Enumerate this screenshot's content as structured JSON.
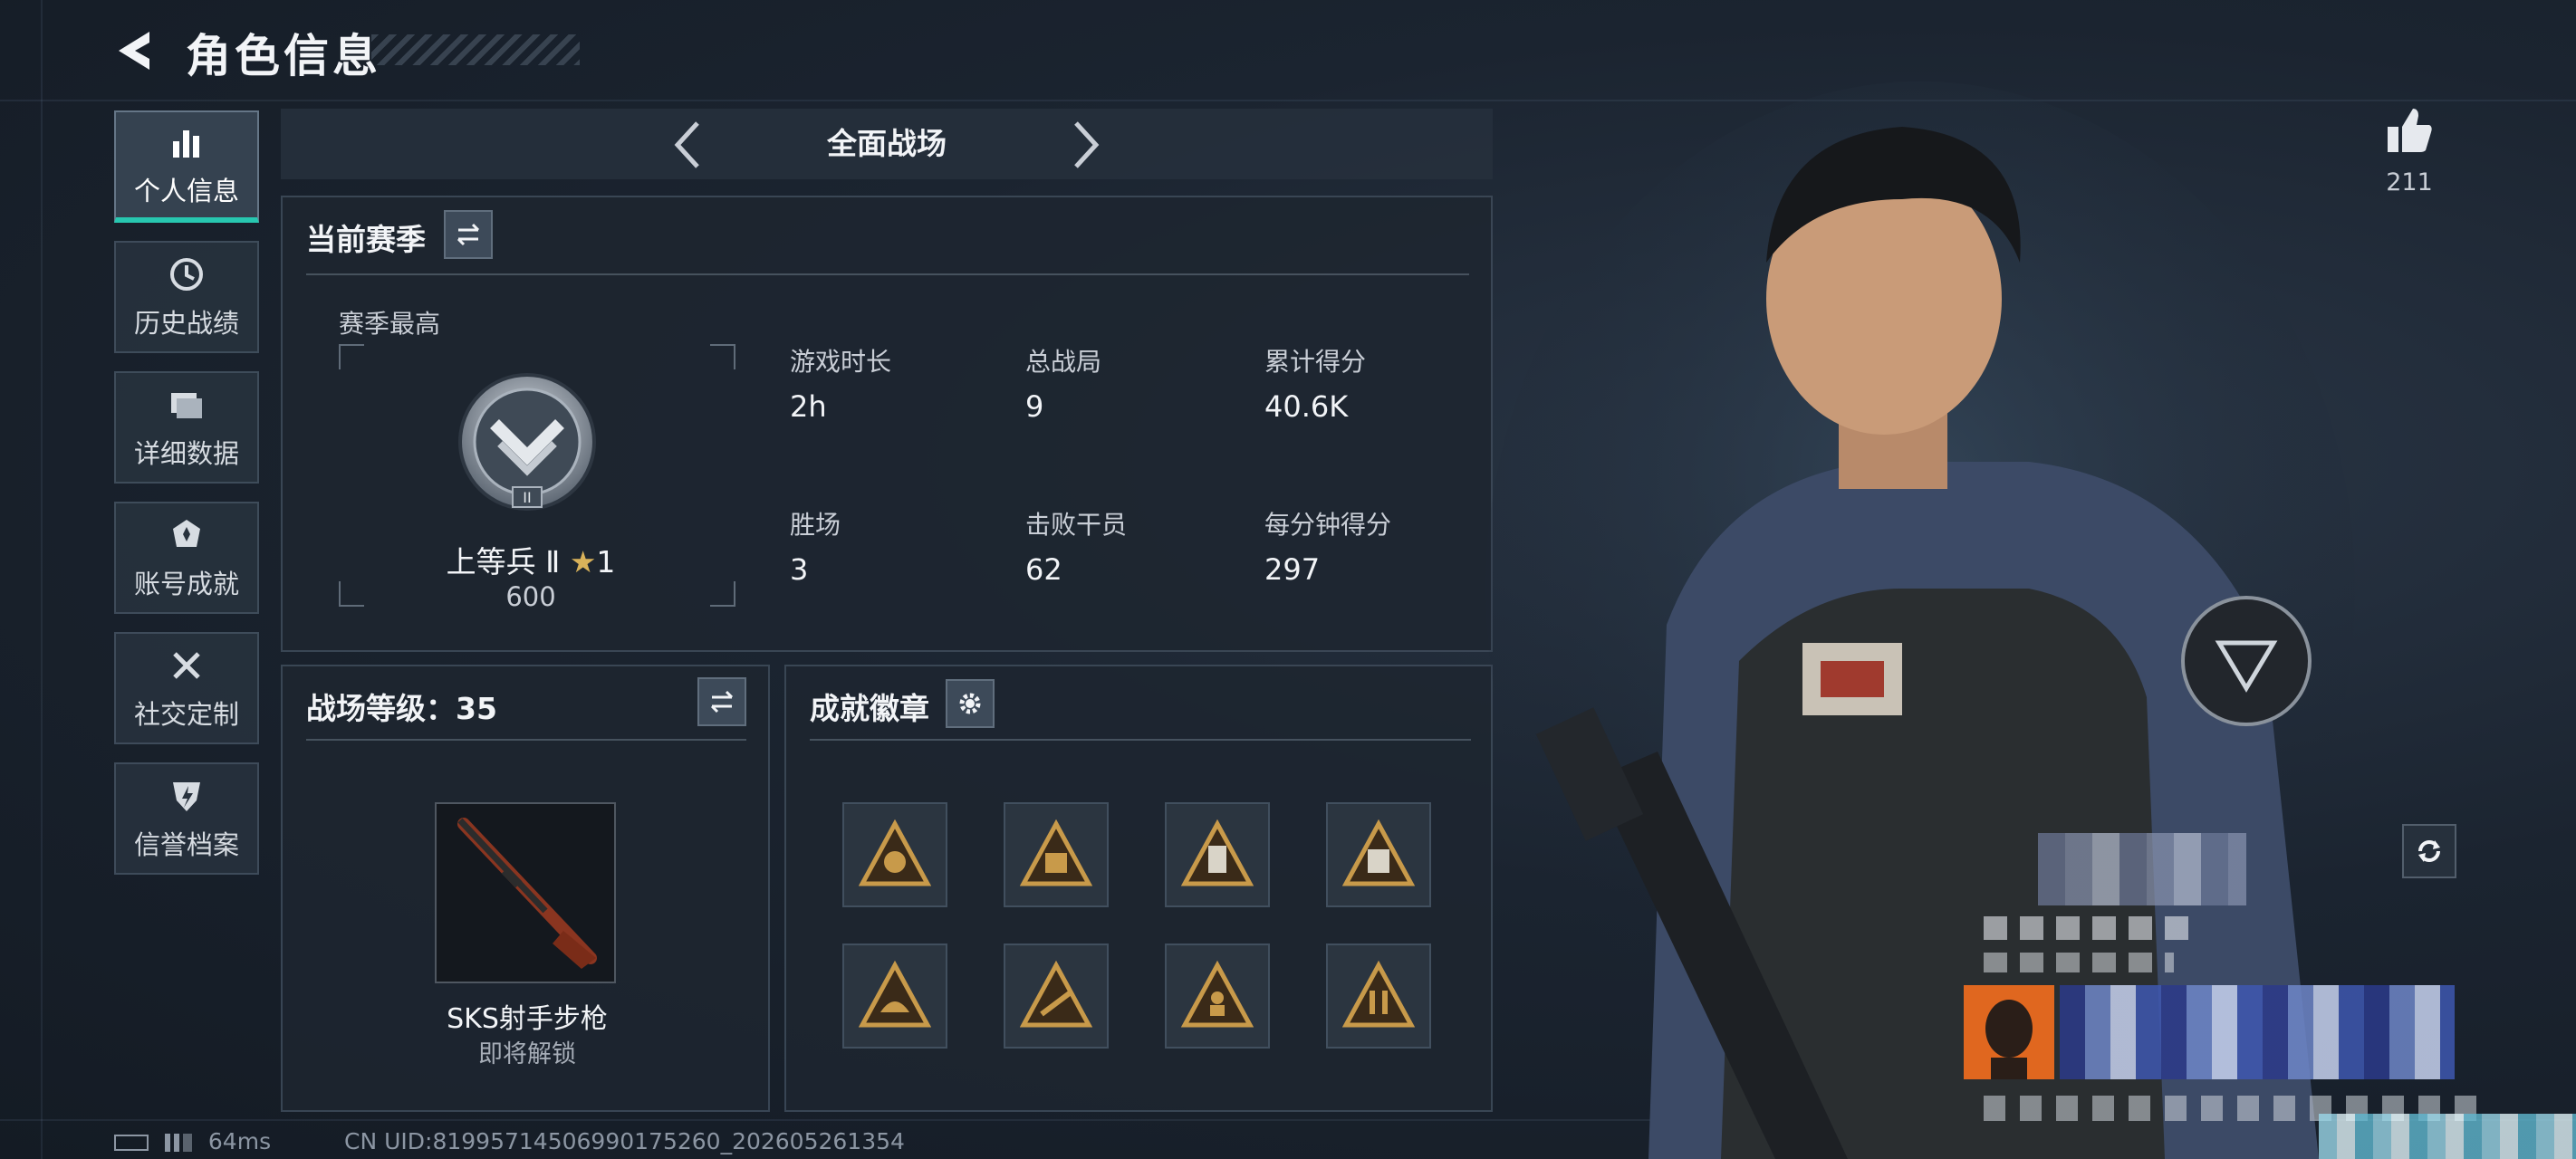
{
  "header": {
    "title": "角色信息"
  },
  "sidebar": {
    "items": [
      {
        "label": "个人信息",
        "icon": "bar-chart-icon",
        "active": true
      },
      {
        "label": "历史战绩",
        "icon": "history-icon",
        "active": false
      },
      {
        "label": "详细数据",
        "icon": "folder-icon",
        "active": false
      },
      {
        "label": "账号成就",
        "icon": "achievement-icon",
        "active": false
      },
      {
        "label": "社交定制",
        "icon": "tools-icon",
        "active": false
      },
      {
        "label": "信誉档案",
        "icon": "shield-icon",
        "active": false
      }
    ]
  },
  "mode": {
    "title": "全面战场"
  },
  "season": {
    "title": "当前赛季",
    "best_label": "赛季最高",
    "rank_name": "上等兵 Ⅱ",
    "rank_stars": "1",
    "rank_points": "600",
    "stats": [
      {
        "label": "游戏时长",
        "value": "2h"
      },
      {
        "label": "总战局",
        "value": "9"
      },
      {
        "label": "累计得分",
        "value": "40.6K"
      },
      {
        "label": "胜场",
        "value": "3"
      },
      {
        "label": "击败干员",
        "value": "62"
      },
      {
        "label": "每分钟得分",
        "value": "297"
      }
    ]
  },
  "battlefield_level": {
    "title": "战场等级：35",
    "weapon_name": "SKS射手步枪",
    "weapon_status": "即将解锁"
  },
  "achievements": {
    "title": "成就徽章",
    "badges": [
      "badge-1",
      "badge-2",
      "badge-3",
      "badge-4",
      "badge-5",
      "badge-6",
      "badge-7",
      "badge-8"
    ]
  },
  "profile": {
    "likes": "211"
  },
  "footer": {
    "ping": "64ms",
    "uid": "CN UID:81995714506990175260_202605261354"
  },
  "colors": {
    "accent": "#27c7b0",
    "badge_gold": "#c89a4a"
  }
}
